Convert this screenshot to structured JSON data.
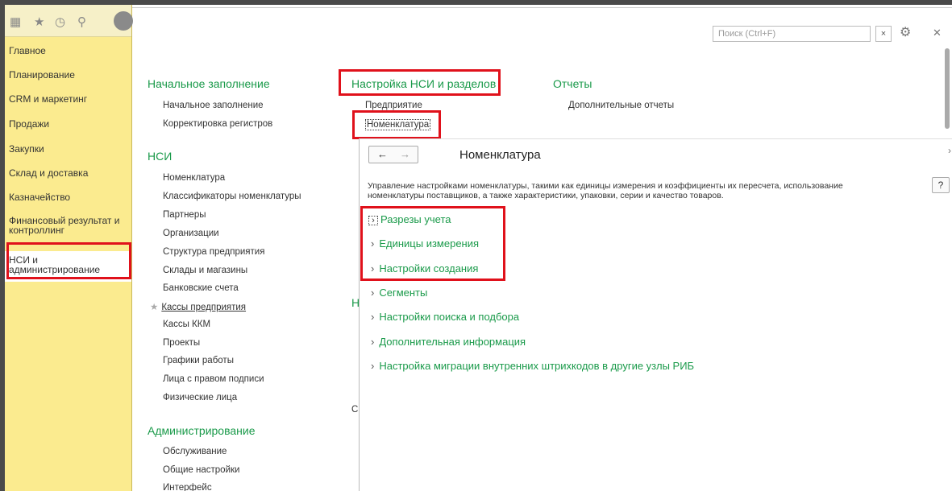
{
  "sidebar": {
    "items": [
      {
        "label": "Главное"
      },
      {
        "label": "Планирование"
      },
      {
        "label": "CRM и маркетинг"
      },
      {
        "label": "Продажи"
      },
      {
        "label": "Закупки"
      },
      {
        "label": "Склад и доставка"
      },
      {
        "label": "Казначейство"
      },
      {
        "label": "Финансовый результат и контроллинг"
      },
      {
        "label": "НСИ и администрирование"
      }
    ]
  },
  "search": {
    "placeholder": "Поиск (Ctrl+F)"
  },
  "sections": {
    "initial_fill": {
      "title": "Начальное заполнение",
      "items": [
        "Начальное заполнение",
        "Корректировка регистров"
      ]
    },
    "nsi": {
      "title": "НСИ",
      "items": [
        "Номенклатура",
        "Классификаторы номенклатуры",
        "Партнеры",
        "Организации",
        "Структура предприятия",
        "Склады и магазины",
        "Банковские счета",
        "Кассы предприятия",
        "Кассы ККМ",
        "Проекты",
        "Графики работы",
        "Лица с правом подписи",
        "Физические лица"
      ]
    },
    "admin": {
      "title": "Администрирование",
      "items": [
        "Обслуживание",
        "Общие настройки",
        "Интерфейс"
      ]
    },
    "nsi_setup": {
      "title": "Настройка НСИ и разделов",
      "items": [
        "Предприятие",
        "Номенклатура"
      ]
    },
    "reports": {
      "title": "Отчеты",
      "items": [
        "Дополнительные отчеты"
      ]
    }
  },
  "panel": {
    "title": "Номенклатура",
    "description": "Управление настройками номенклатуры, такими как единицы измерения и коэффициенты их пересчета, использование номенклатуры поставщиков, а также характеристики, упаковки, серии и качество товаров.",
    "help": "?",
    "groups": [
      "Разрезы учета",
      "Единицы измерения",
      "Настройки создания",
      "Сегменты",
      "Настройки поиска и подбора",
      "Дополнительная информация",
      "Настройка миграции внутренних штрихкодов в другие узлы РИБ"
    ]
  },
  "colors": {
    "accent": "#1a9a4a",
    "highlight": "#e0111b",
    "sidebar": "#fbeb8f"
  }
}
